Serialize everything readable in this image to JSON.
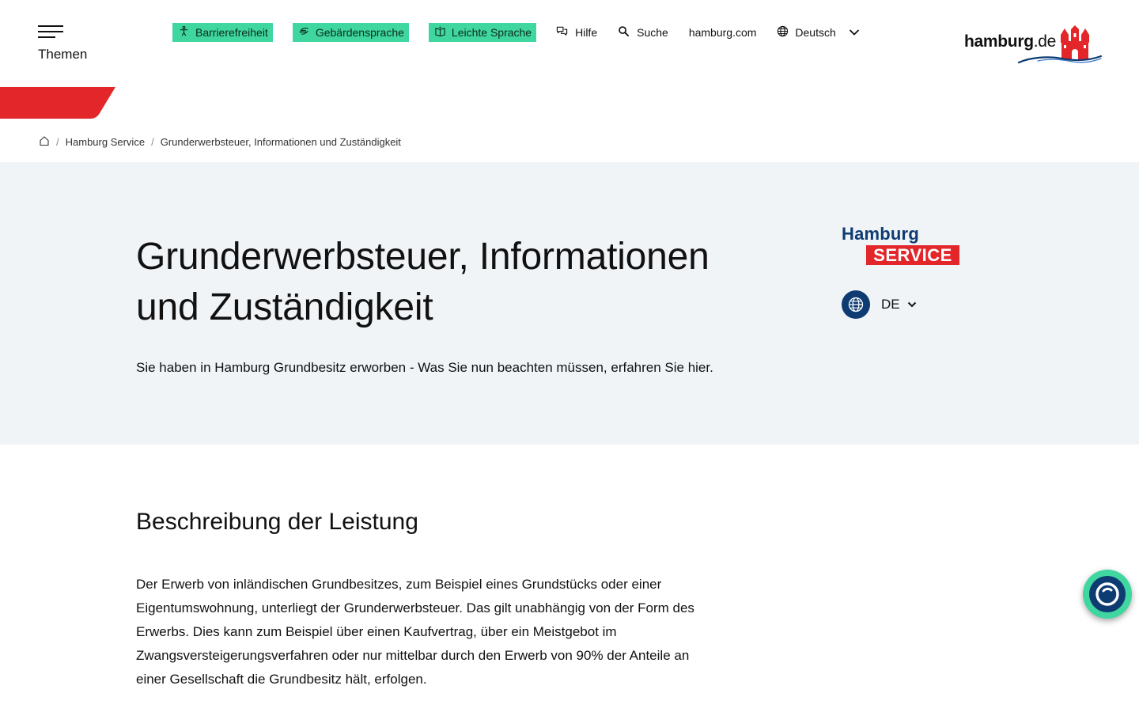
{
  "header": {
    "menu_label": "Themen",
    "nav": {
      "accessibility": "Barrierefreiheit",
      "sign_language": "Gebärdensprache",
      "easy_language": "Leichte Sprache",
      "help": "Hilfe",
      "search": "Suche",
      "external": "hamburg.com",
      "language": "Deutsch"
    },
    "brand": {
      "name": "hamburg",
      "tld": ".de"
    },
    "colors": {
      "accent_green": "#3fd6a0",
      "accent_red": "#e3262a",
      "brand_blue": "#0d3b72"
    }
  },
  "breadcrumb": {
    "items": [
      "Hamburg Service",
      "Grunderwerbsteuer, Informationen und Zuständigkeit"
    ]
  },
  "hero": {
    "title": "Grunderwerbsteuer, Informationen und Zuständigkeit",
    "lead": "Sie haben in Hamburg Grundbesitz erworben - Was Sie nun beachten müssen, erfahren Sie hier.",
    "service_logo": {
      "top": "Hamburg",
      "bottom": "SERVICE"
    },
    "language_code": "DE"
  },
  "content": {
    "section_title": "Beschreibung der Leistung",
    "section_text": "Der Erwerb von inländischen Grundbesitzes, zum Beispiel eines Grundstücks oder einer Eigentumswohnung, unterliegt der Grunderwerbsteuer. Das gilt unabhängig von der Form des Erwerbs. Dies kann zum Beispiel über einen Kaufvertrag, über ein Meistgebot im Zwangsversteigerungsverfahren oder nur mittelbar durch den Erwerb von 90% der Anteile an einer Gesellschaft die Grundbesitz hält, erfolgen."
  }
}
